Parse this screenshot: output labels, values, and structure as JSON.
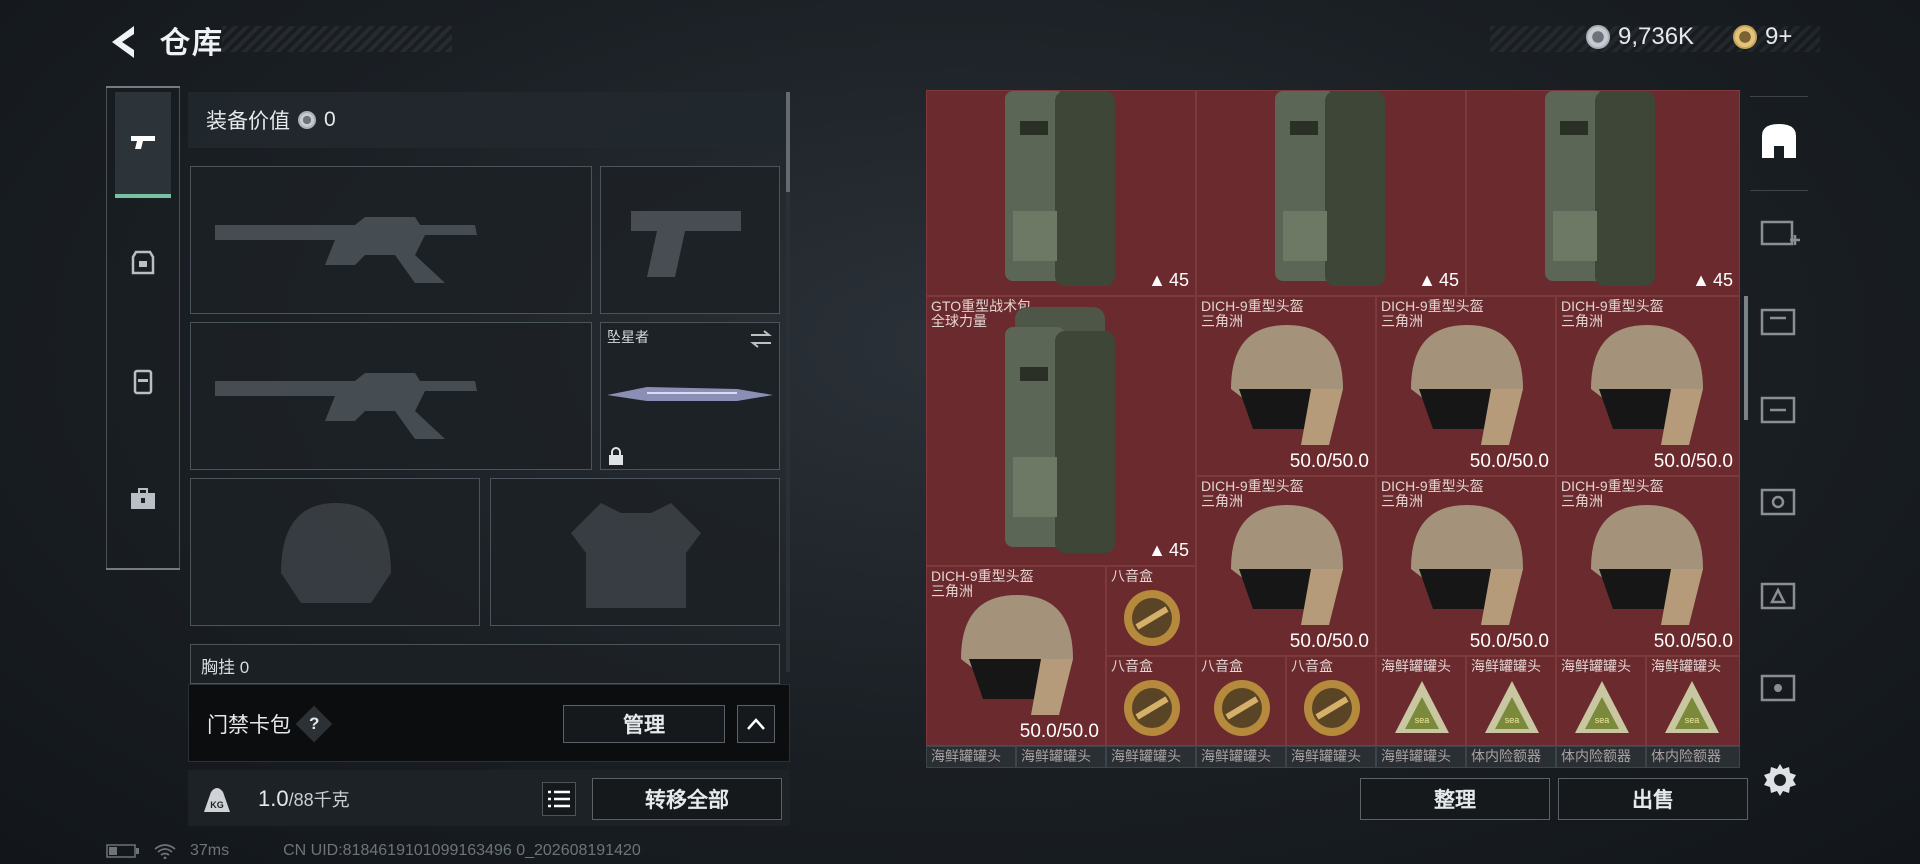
{
  "header": {
    "title": "仓库",
    "currency_primary": "9,736K",
    "currency_secondary": "9+"
  },
  "left_tabs": [
    {
      "name": "weapon",
      "active": true
    },
    {
      "name": "armor",
      "active": false
    },
    {
      "name": "backpack",
      "active": false
    },
    {
      "name": "medkit",
      "active": false
    }
  ],
  "loadout": {
    "value_label": "装备价值",
    "value_amount": "0",
    "melee_name": "坠星者",
    "chest_rig_label": "胸挂",
    "chest_rig_count": "0"
  },
  "keycard": {
    "label": "门禁卡包",
    "help": "?",
    "manage_label": "管理"
  },
  "weight": {
    "current": "1.0",
    "capacity": "/88千克",
    "transfer_all_label": "转移全部"
  },
  "status": {
    "ping": "37ms",
    "uid": "CN UID:8184619101099163496 0_202608191420"
  },
  "warehouse": {
    "backpack_name": "GTO重型战术包\n全球力量",
    "backpack_count": "45",
    "helmet_name": "DICH-9重型头盔\n三角洲",
    "helmet_durability": "50.0/50.0",
    "music_box_name": "八音盒",
    "seafood_can_name": "海鲜罐罐头",
    "seafood_can_name_bottom": "海鲜罐罐头",
    "implant_name": "体内险额器"
  },
  "actions": {
    "sort_label": "整理",
    "sell_label": "出售"
  },
  "colors": {
    "grid_red": "#6b2a2d",
    "accent_green": "#7ac1a1"
  }
}
